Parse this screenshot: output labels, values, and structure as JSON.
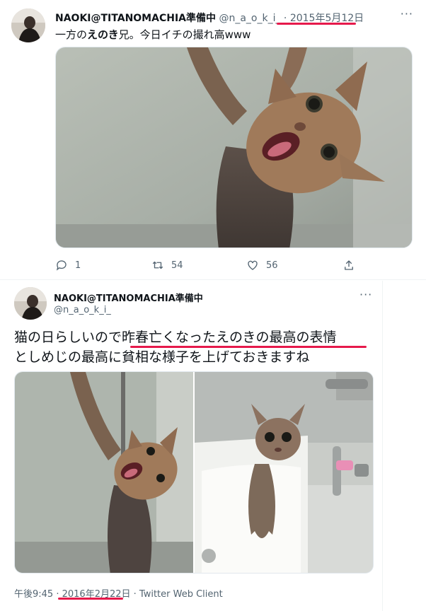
{
  "tweet1": {
    "name": "NAOKI@TITANOMACHIA準備中",
    "handle": "@n_a_o_k_i_",
    "separator": " · ",
    "date": "2015年5月12日",
    "text_pre": "一方の",
    "text_bold": "えのき",
    "text_post": "兄。今日イチの撮れ高www",
    "more": "···",
    "actions": {
      "reply_count": "1",
      "retweet_count": "54",
      "like_count": "56"
    }
  },
  "tweet2": {
    "name": "NAOKI@TITANOMACHIA準備中",
    "handle": "@n_a_o_k_i_",
    "more": "···",
    "text_line1_pre": "猫の日らしいので",
    "text_line1_mark": "昨春亡くなったえのきの最高の表情",
    "text_line2": "としめじの最高に貧相な様子を上げておきますね",
    "footer_time": "午後9:45",
    "footer_sep": " · ",
    "footer_date": "2016年2月22日",
    "footer_client": " · Twitter Web Client"
  },
  "colors": {
    "highlight": "#e6194b",
    "muted": "#536471",
    "text": "#0f1419"
  },
  "icons": [
    "more-icon",
    "reply-icon",
    "retweet-icon",
    "like-icon",
    "share-icon"
  ]
}
